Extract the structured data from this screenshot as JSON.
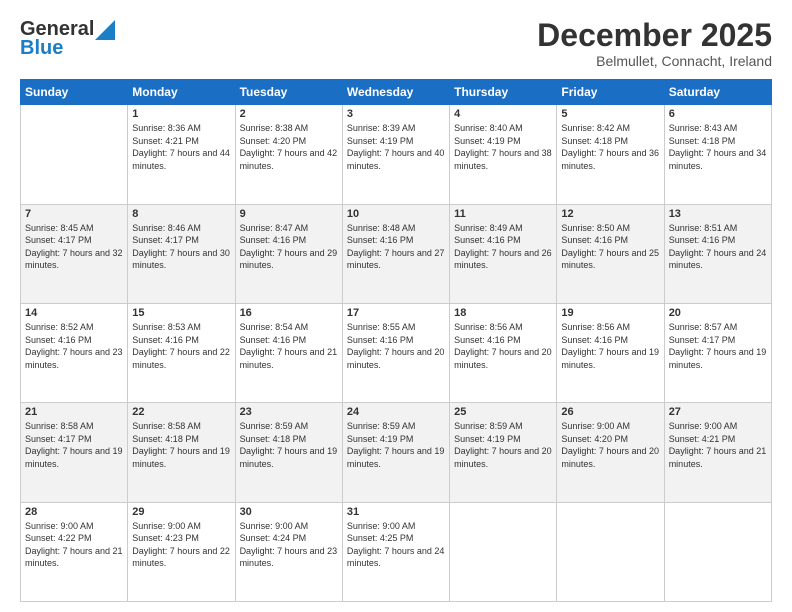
{
  "header": {
    "logo_general": "General",
    "logo_blue": "Blue",
    "month_title": "December 2025",
    "location": "Belmullet, Connacht, Ireland"
  },
  "days_of_week": [
    "Sunday",
    "Monday",
    "Tuesday",
    "Wednesday",
    "Thursday",
    "Friday",
    "Saturday"
  ],
  "weeks": [
    [
      {
        "num": "",
        "sunrise": "",
        "sunset": "",
        "daylight": "",
        "empty": true
      },
      {
        "num": "1",
        "sunrise": "Sunrise: 8:36 AM",
        "sunset": "Sunset: 4:21 PM",
        "daylight": "Daylight: 7 hours and 44 minutes."
      },
      {
        "num": "2",
        "sunrise": "Sunrise: 8:38 AM",
        "sunset": "Sunset: 4:20 PM",
        "daylight": "Daylight: 7 hours and 42 minutes."
      },
      {
        "num": "3",
        "sunrise": "Sunrise: 8:39 AM",
        "sunset": "Sunset: 4:19 PM",
        "daylight": "Daylight: 7 hours and 40 minutes."
      },
      {
        "num": "4",
        "sunrise": "Sunrise: 8:40 AM",
        "sunset": "Sunset: 4:19 PM",
        "daylight": "Daylight: 7 hours and 38 minutes."
      },
      {
        "num": "5",
        "sunrise": "Sunrise: 8:42 AM",
        "sunset": "Sunset: 4:18 PM",
        "daylight": "Daylight: 7 hours and 36 minutes."
      },
      {
        "num": "6",
        "sunrise": "Sunrise: 8:43 AM",
        "sunset": "Sunset: 4:18 PM",
        "daylight": "Daylight: 7 hours and 34 minutes."
      }
    ],
    [
      {
        "num": "7",
        "sunrise": "Sunrise: 8:45 AM",
        "sunset": "Sunset: 4:17 PM",
        "daylight": "Daylight: 7 hours and 32 minutes."
      },
      {
        "num": "8",
        "sunrise": "Sunrise: 8:46 AM",
        "sunset": "Sunset: 4:17 PM",
        "daylight": "Daylight: 7 hours and 30 minutes."
      },
      {
        "num": "9",
        "sunrise": "Sunrise: 8:47 AM",
        "sunset": "Sunset: 4:16 PM",
        "daylight": "Daylight: 7 hours and 29 minutes."
      },
      {
        "num": "10",
        "sunrise": "Sunrise: 8:48 AM",
        "sunset": "Sunset: 4:16 PM",
        "daylight": "Daylight: 7 hours and 27 minutes."
      },
      {
        "num": "11",
        "sunrise": "Sunrise: 8:49 AM",
        "sunset": "Sunset: 4:16 PM",
        "daylight": "Daylight: 7 hours and 26 minutes."
      },
      {
        "num": "12",
        "sunrise": "Sunrise: 8:50 AM",
        "sunset": "Sunset: 4:16 PM",
        "daylight": "Daylight: 7 hours and 25 minutes."
      },
      {
        "num": "13",
        "sunrise": "Sunrise: 8:51 AM",
        "sunset": "Sunset: 4:16 PM",
        "daylight": "Daylight: 7 hours and 24 minutes."
      }
    ],
    [
      {
        "num": "14",
        "sunrise": "Sunrise: 8:52 AM",
        "sunset": "Sunset: 4:16 PM",
        "daylight": "Daylight: 7 hours and 23 minutes."
      },
      {
        "num": "15",
        "sunrise": "Sunrise: 8:53 AM",
        "sunset": "Sunset: 4:16 PM",
        "daylight": "Daylight: 7 hours and 22 minutes."
      },
      {
        "num": "16",
        "sunrise": "Sunrise: 8:54 AM",
        "sunset": "Sunset: 4:16 PM",
        "daylight": "Daylight: 7 hours and 21 minutes."
      },
      {
        "num": "17",
        "sunrise": "Sunrise: 8:55 AM",
        "sunset": "Sunset: 4:16 PM",
        "daylight": "Daylight: 7 hours and 20 minutes."
      },
      {
        "num": "18",
        "sunrise": "Sunrise: 8:56 AM",
        "sunset": "Sunset: 4:16 PM",
        "daylight": "Daylight: 7 hours and 20 minutes."
      },
      {
        "num": "19",
        "sunrise": "Sunrise: 8:56 AM",
        "sunset": "Sunset: 4:16 PM",
        "daylight": "Daylight: 7 hours and 19 minutes."
      },
      {
        "num": "20",
        "sunrise": "Sunrise: 8:57 AM",
        "sunset": "Sunset: 4:17 PM",
        "daylight": "Daylight: 7 hours and 19 minutes."
      }
    ],
    [
      {
        "num": "21",
        "sunrise": "Sunrise: 8:58 AM",
        "sunset": "Sunset: 4:17 PM",
        "daylight": "Daylight: 7 hours and 19 minutes."
      },
      {
        "num": "22",
        "sunrise": "Sunrise: 8:58 AM",
        "sunset": "Sunset: 4:18 PM",
        "daylight": "Daylight: 7 hours and 19 minutes."
      },
      {
        "num": "23",
        "sunrise": "Sunrise: 8:59 AM",
        "sunset": "Sunset: 4:18 PM",
        "daylight": "Daylight: 7 hours and 19 minutes."
      },
      {
        "num": "24",
        "sunrise": "Sunrise: 8:59 AM",
        "sunset": "Sunset: 4:19 PM",
        "daylight": "Daylight: 7 hours and 19 minutes."
      },
      {
        "num": "25",
        "sunrise": "Sunrise: 8:59 AM",
        "sunset": "Sunset: 4:19 PM",
        "daylight": "Daylight: 7 hours and 20 minutes."
      },
      {
        "num": "26",
        "sunrise": "Sunrise: 9:00 AM",
        "sunset": "Sunset: 4:20 PM",
        "daylight": "Daylight: 7 hours and 20 minutes."
      },
      {
        "num": "27",
        "sunrise": "Sunrise: 9:00 AM",
        "sunset": "Sunset: 4:21 PM",
        "daylight": "Daylight: 7 hours and 21 minutes."
      }
    ],
    [
      {
        "num": "28",
        "sunrise": "Sunrise: 9:00 AM",
        "sunset": "Sunset: 4:22 PM",
        "daylight": "Daylight: 7 hours and 21 minutes."
      },
      {
        "num": "29",
        "sunrise": "Sunrise: 9:00 AM",
        "sunset": "Sunset: 4:23 PM",
        "daylight": "Daylight: 7 hours and 22 minutes."
      },
      {
        "num": "30",
        "sunrise": "Sunrise: 9:00 AM",
        "sunset": "Sunset: 4:24 PM",
        "daylight": "Daylight: 7 hours and 23 minutes."
      },
      {
        "num": "31",
        "sunrise": "Sunrise: 9:00 AM",
        "sunset": "Sunset: 4:25 PM",
        "daylight": "Daylight: 7 hours and 24 minutes."
      },
      {
        "num": "",
        "sunrise": "",
        "sunset": "",
        "daylight": "",
        "empty": true
      },
      {
        "num": "",
        "sunrise": "",
        "sunset": "",
        "daylight": "",
        "empty": true
      },
      {
        "num": "",
        "sunrise": "",
        "sunset": "",
        "daylight": "",
        "empty": true
      }
    ]
  ]
}
